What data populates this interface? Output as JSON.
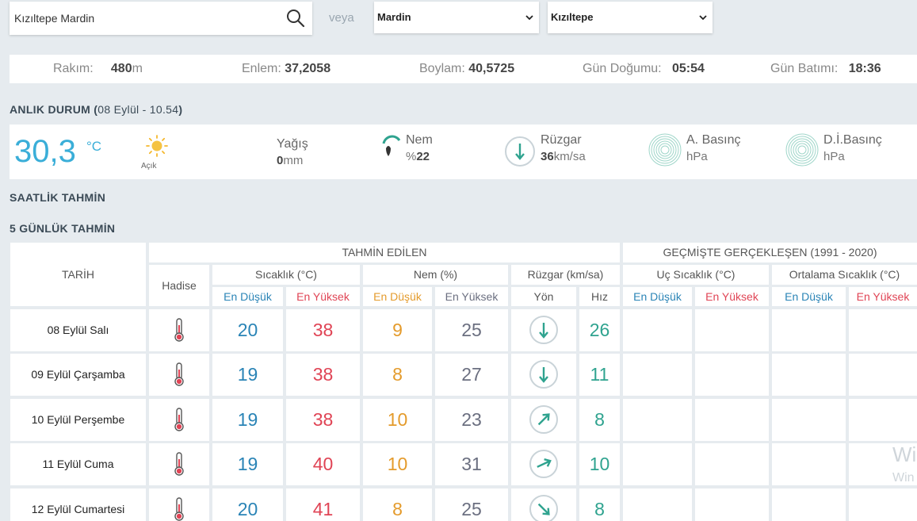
{
  "search": {
    "value": "Kızıltepe Mardin",
    "icon": "search-icon"
  },
  "veya": "veya",
  "city_select": {
    "value": "Mardin"
  },
  "district_select": {
    "value": "Kızıltepe"
  },
  "info": {
    "altitude_label": "Rakım:",
    "altitude_value": "480",
    "altitude_unit": "m",
    "lat_label": "Enlem:",
    "lat_value": "37,2058",
    "lon_label": "Boylam:",
    "lon_value": "40,5725",
    "sunrise_label": "Gün Doğumu:",
    "sunrise_value": "05:54",
    "sunset_label": "Gün Batımı:",
    "sunset_value": "18:36"
  },
  "current": {
    "title": "ANLIK DURUM",
    "paren_open": "(",
    "time": "08 Eylül - 10.54",
    "paren_close": ")",
    "temp": "30,3",
    "temp_unit": "°C",
    "condition": "Açık",
    "rain_label": "Yağış",
    "rain_value": "0",
    "rain_unit": "mm",
    "humidity_label": "Nem",
    "humidity_prefix": "%",
    "humidity_value": "22",
    "wind_label": "Rüzgar",
    "wind_value": "36",
    "wind_unit": "km/sa",
    "pressure_label": "A. Basınç",
    "pressure_unit": "hPa",
    "sea_pressure_label": "D.İ.Basınç",
    "sea_pressure_unit": "hPa"
  },
  "hourly_title": "SAATLİK TAHMİN",
  "daily_title": "5 GÜNLÜK TAHMİN",
  "table": {
    "date_header": "TARİH",
    "forecast_header": "TAHMİN EDİLEN",
    "past_header": "GEÇMİŞTE GERÇEKLEŞEN (1991 - 2020)",
    "event_header": "Hadise",
    "temp_header": "Sıcaklık (°C)",
    "humidity_header": "Nem (%)",
    "wind_header": "Rüzgar (km/sa)",
    "extreme_header": "Uç Sıcaklık (°C)",
    "avg_header": "Ortalama Sıcaklık (°C)",
    "low": "En Düşük",
    "high": "En Yüksek",
    "direction": "Yön",
    "speed": "Hız",
    "rows": [
      {
        "date": "08 Eylül Salı",
        "tmin": "20",
        "tmax": "38",
        "hmin": "9",
        "hmax": "25",
        "wdir_deg": 180,
        "wspeed": "26"
      },
      {
        "date": "09 Eylül Çarşamba",
        "tmin": "19",
        "tmax": "38",
        "hmin": "8",
        "hmax": "27",
        "wdir_deg": 180,
        "wspeed": "11"
      },
      {
        "date": "10 Eylül Perşembe",
        "tmin": "19",
        "tmax": "38",
        "hmin": "10",
        "hmax": "23",
        "wdir_deg": 45,
        "wspeed": "8"
      },
      {
        "date": "11 Eylül Cuma",
        "tmin": "19",
        "tmax": "40",
        "hmin": "10",
        "hmax": "31",
        "wdir_deg": 65,
        "wspeed": "10"
      },
      {
        "date": "12 Eylül Cumartesi",
        "tmin": "20",
        "tmax": "41",
        "hmin": "8",
        "hmax": "25",
        "wdir_deg": 135,
        "wspeed": "8"
      }
    ]
  },
  "watermark": {
    "line1": "Wi",
    "line2": "Win"
  },
  "colors": {
    "accent": "#3aaed8",
    "low": "#2a84b6",
    "high": "#e04455",
    "humidity_low": "#e49b2c",
    "teal": "#2fa38f"
  }
}
